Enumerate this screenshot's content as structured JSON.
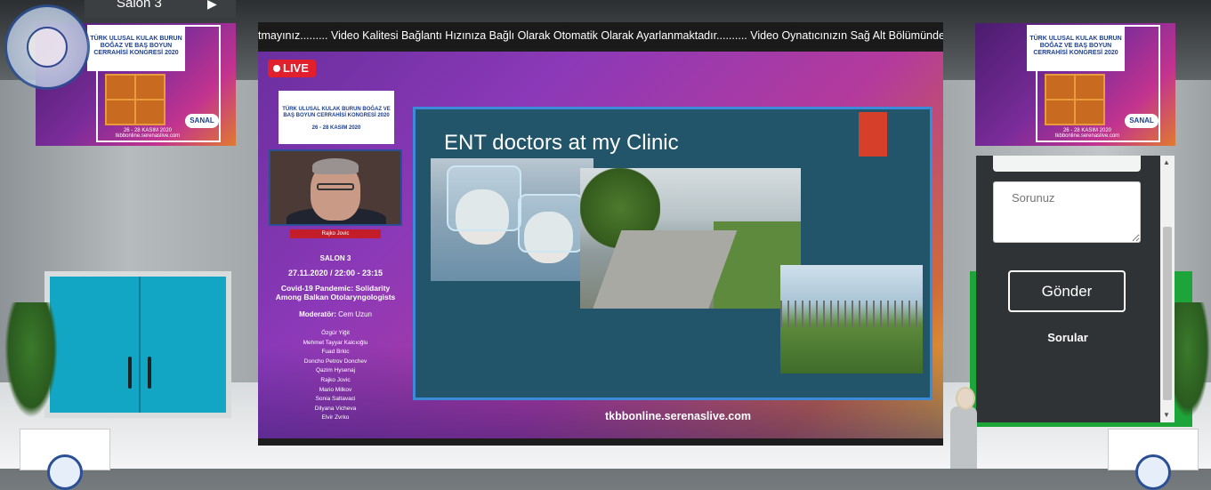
{
  "top_bar": {
    "salon_label": "Salon 3",
    "play_glyph": "▶"
  },
  "logo": {
    "ring_text": "TÜRK KULAK BURUN BOĞAZ VE BAŞ BOYUN CERRAHİSİ DERNEĞİ 1935",
    "icon": "association-logo-icon"
  },
  "poster": {
    "title": "TÜRK ULUSAL KULAK BURUN BOĞAZ VE BAŞ BOYUN CERRAHİSİ KONGRESİ 2020",
    "date": "26 - 28 KASIM 2020",
    "site": "tkbbonline.serenaslive.com",
    "badge": "SANAL"
  },
  "player": {
    "ticker": "tmayınız......... Video Kalitesi Bağlantı Hızınıza Bağlı Olarak Otomatik Olarak Ayarlanmaktadır.......... Video Oynatıcınızın Sağ Alt Bölümünde Yer Alan Çarkın",
    "live_label": "LIVE",
    "live_color": "#e21f2c",
    "session_logo_title": "TÜRK ULUSAL KULAK BURUN BOĞAZ VE BAŞ BOYUN CERRAHİSİ KONGRESİ 2020",
    "session_logo_date": "26 - 28 KASIM 2020",
    "speaker_name": "Rajko Jovic",
    "salon": "SALON 3",
    "time": "27.11.2020 / 22:00 - 23:15",
    "topic": "Covid-19 Pandemic: Solidarity Among Balkan Otolaryngologists",
    "moderator_label": "Moderatör:",
    "moderator_name": "Cem Uzun",
    "panelists": [
      "Özgür Yiğit",
      "Mehmet Tayyar Kalcıoğlu",
      "Fuad Brkic",
      "Doncho Petrov Donchev",
      "Qazim Hysenaj",
      "Rajko Jovic",
      "Mario Milkov",
      "Sonia Saltavaci",
      "Dilyana Vicheva",
      "Elvir Zvrko"
    ],
    "slide_title": "ENT doctors  at my Clinic",
    "slide_url": "tkbbonline.serenaslive.com"
  },
  "qa": {
    "question_placeholder": "Sorunuz",
    "submit_label": "Gönder",
    "questions_label": "Sorular",
    "scroll_up": "▲",
    "scroll_down": "▼"
  }
}
